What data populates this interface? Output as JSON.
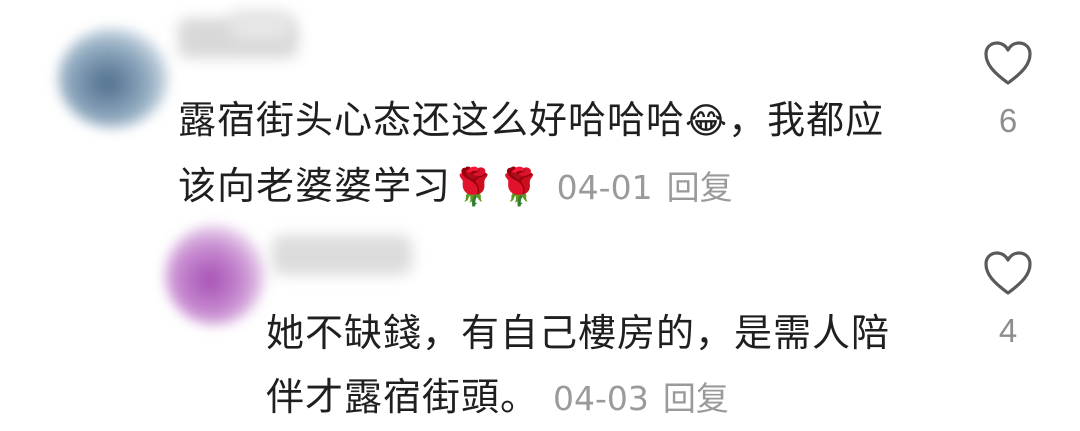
{
  "comments": [
    {
      "text_line1": "露宿街头心态还这么好哈哈哈",
      "emoji_laugh": "😂",
      "text_line1_end": "，我都应",
      "text_line2": "该向老婆婆学习",
      "emoji_rose": "🌹",
      "date": "04-01",
      "reply_label": "回复",
      "like_count": "6",
      "avatar_color": "#6f8aa3"
    },
    {
      "text_line1": "她不缺錢，有自己樓房的，是需人陪",
      "text_line2": "伴才露宿街頭。",
      "date": "04-03",
      "reply_label": "回复",
      "like_count": "4",
      "avatar_color": "#b46fc0"
    }
  ],
  "icons": {
    "like": "heart-outline-icon"
  },
  "colors": {
    "meta_gray": "#9a9a9a",
    "text": "#1f1f1f"
  }
}
